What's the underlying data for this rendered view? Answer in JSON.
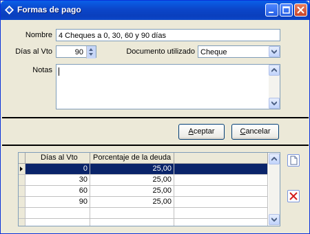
{
  "window": {
    "title": "Formas de pago"
  },
  "form": {
    "nombre_label": "Nombre",
    "nombre_value": "4 Cheques a 0, 30, 60 y 90 días",
    "dias_label": "Días al Vto",
    "dias_value": "90",
    "documento_label": "Documento utilizado",
    "documento_value": "Cheque",
    "notas_label": "Notas",
    "notas_value": ""
  },
  "buttons": {
    "aceptar_u": "A",
    "aceptar_rest": "ceptar",
    "cancelar_u": "C",
    "cancelar_rest": "ancelar"
  },
  "grid": {
    "columns": [
      "Días al Vto",
      "Porcentaje de la deuda"
    ],
    "rows": [
      {
        "dias": "0",
        "pct": "25,00"
      },
      {
        "dias": "30",
        "pct": "25,00"
      },
      {
        "dias": "60",
        "pct": "25,00"
      },
      {
        "dias": "90",
        "pct": "25,00"
      }
    ]
  },
  "icons": {
    "add": "new-document-icon",
    "delete": "delete-x-icon"
  }
}
